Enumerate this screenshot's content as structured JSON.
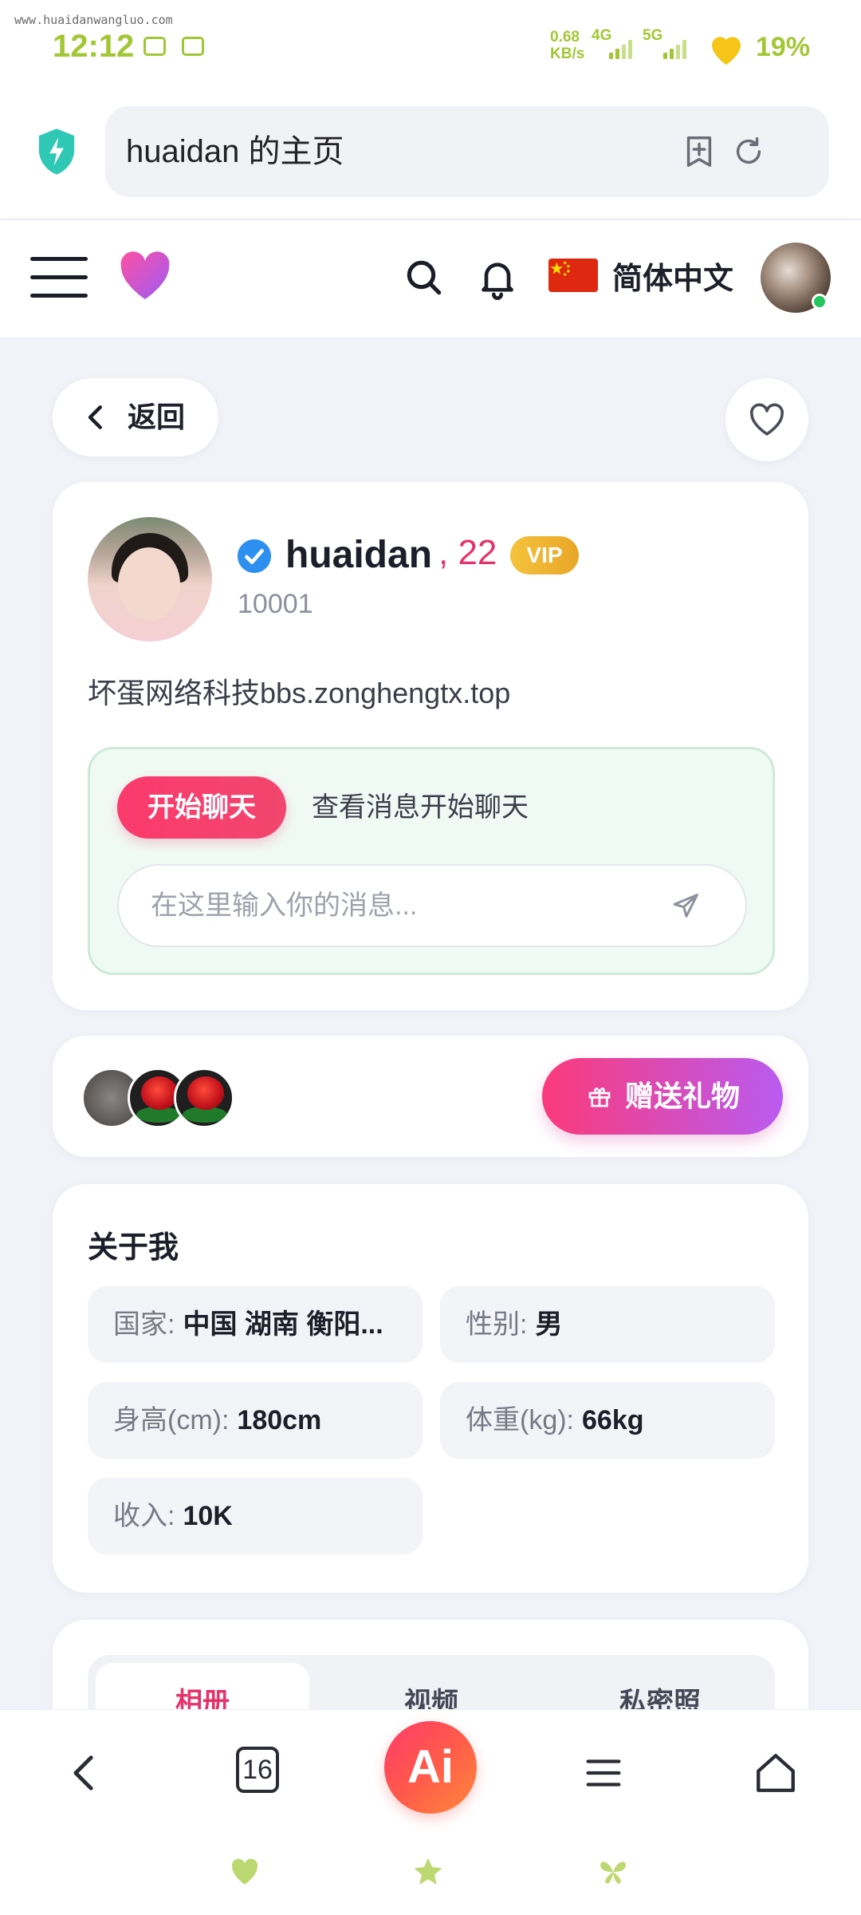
{
  "status_bar": {
    "watermark": "www.huaidanwangluo.com",
    "time": "12:12",
    "net_speed_value": "0.68",
    "net_speed_unit": "KB/s",
    "network_1": "4G",
    "network_2": "5G",
    "battery": "19%",
    "accent_color": "#a2c734"
  },
  "browser": {
    "url_title": "huaidan 的主页",
    "icons": [
      "shield-icon",
      "add-bookmark-icon",
      "refresh-icon"
    ]
  },
  "header": {
    "language": "简体中文",
    "icons": [
      "menu-icon",
      "heart-logo-icon",
      "search-icon",
      "bell-icon",
      "china-flag-icon"
    ]
  },
  "nav": {
    "back_label": "返回"
  },
  "profile": {
    "name": "huaidan",
    "age": ", 22",
    "badge": "VIP",
    "id": "10001",
    "bio": "坏蛋网络科技bbs.zonghengtx.top",
    "verified": true
  },
  "chat": {
    "start_button": "开始聊天",
    "hint": "查看消息开始聊天",
    "input_placeholder": "在这里输入你的消息..."
  },
  "gifts": {
    "button_label": "赠送礼物"
  },
  "about": {
    "title": "关于我",
    "fields": [
      {
        "key": "国家:",
        "value": "中国 湖南 衡阳..."
      },
      {
        "key": "性别:",
        "value": "男"
      },
      {
        "key": "身高(cm):",
        "value": "180cm"
      },
      {
        "key": "体重(kg):",
        "value": "66kg"
      },
      {
        "key": "收入:",
        "value": "10K"
      }
    ]
  },
  "media_tabs": [
    {
      "label": "相册",
      "active": true
    },
    {
      "label": "视频",
      "active": false
    },
    {
      "label": "私密照",
      "active": false
    }
  ],
  "bottom_nav": {
    "tab_count": "16",
    "ai_label": "Ai",
    "icons": [
      "back-arrow-icon",
      "tabs-icon",
      "ai-assistant-icon",
      "menu-icon",
      "home-icon"
    ]
  },
  "colors": {
    "brand_pink": "#e5326a",
    "gift_gradient_start": "#fb3a7a",
    "gift_gradient_end": "#b95bf0",
    "vip_gold": "#f4c33c",
    "page_bg": "#f1f3f8"
  }
}
